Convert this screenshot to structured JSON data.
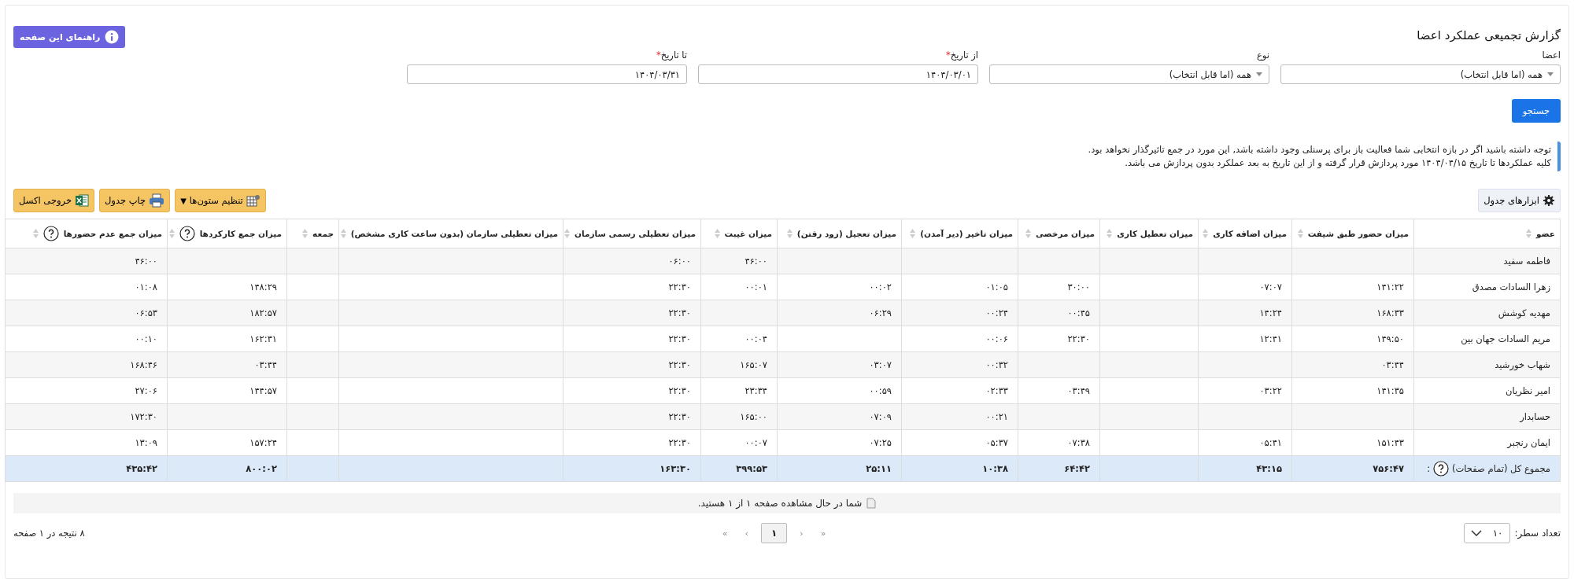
{
  "page": {
    "title": "گزارش تجمیعی عملکرد اعضا",
    "help_button": "راهنمای این صفحه"
  },
  "filters": [
    {
      "kind": "select",
      "label": "اعضا",
      "value": "همه (اما قابل انتخاب)"
    },
    {
      "kind": "select",
      "label": "نوع",
      "value": "همه (اما قابل انتخاب)"
    },
    {
      "kind": "date",
      "label": "از تاریخ",
      "required_mark": "*",
      "value": "۱۴۰۴/۰۳/۰۱"
    },
    {
      "kind": "date",
      "label": "تا تاریخ",
      "required_mark": "*",
      "value": "۱۴۰۴/۰۳/۳۱"
    }
  ],
  "search_button": "جستجو",
  "notice": [
    "توجه داشته باشید اگر در بازه انتخابی شما فعالیت باز برای پرسنلی وجود داشته باشد, این مورد در جمع تاثیرگذار نخواهد بود.",
    "کلیه عملکردها تا تاریخ ۱۴۰۴/۰۴/۱۵ مورد پردازش قرار گرفته و از این تاریخ به بعد عملکرد بدون پردازش می باشد."
  ],
  "toolbar": {
    "table_tools": "ابزارهای جدول",
    "buttons": [
      {
        "kind": "columns",
        "label": "تنظیم ستون‌ها",
        "caret": "▼"
      },
      {
        "kind": "print",
        "label": "چاپ جدول"
      },
      {
        "kind": "excel",
        "label": "خروجی اکسل"
      }
    ]
  },
  "table": {
    "columns": [
      {
        "label": "عضو"
      },
      {
        "label": "میزان حضور طبق شیفت"
      },
      {
        "label": "میزان اضافه کاری"
      },
      {
        "label": "میزان تعطیل کاری"
      },
      {
        "label": "میزان مرخصی"
      },
      {
        "label": "میزان تاخیر (دیر آمدن)"
      },
      {
        "label": "میزان تعجیل (زود رفتن)"
      },
      {
        "label": "میزان غیبت"
      },
      {
        "label": "میزان تعطیلی رسمی سازمان"
      },
      {
        "label": "میزان تعطیلی سازمان (بدون ساعت کاری مشخص)"
      },
      {
        "label": "جمعه"
      },
      {
        "label": "میزان جمع کارکردها",
        "help": true
      },
      {
        "label": "میزان جمع عدم حضورها",
        "help": true
      }
    ],
    "rows": [
      [
        "فاطمه سفید",
        null,
        null,
        null,
        null,
        null,
        null,
        "۴۶:۰۰",
        "۰۶:۰۰",
        null,
        null,
        null,
        "۴۶:۰۰"
      ],
      [
        "زهرا السادات مصدق",
        "۱۴۱:۲۲",
        "۰۷:۰۷",
        null,
        "۳۰:۰۰",
        "۰۱:۰۵",
        "۰۰:۰۲",
        "۰۰:۰۱",
        "۲۲:۳۰",
        null,
        null,
        "۱۴۸:۲۹",
        "۰۱:۰۸"
      ],
      [
        "مهدیه کوشش",
        "۱۶۸:۳۳",
        "۱۴:۲۴",
        null,
        "۰۰:۴۵",
        "۰۰:۲۴",
        "۰۶:۲۹",
        null,
        "۲۲:۳۰",
        null,
        null,
        "۱۸۲:۵۷",
        "۰۶:۵۳"
      ],
      [
        "مریم السادات جهان بین",
        "۱۴۹:۵۰",
        "۱۲:۴۱",
        null,
        "۲۲:۳۰",
        "۰۰:۰۶",
        null,
        "۰۰:۰۴",
        "۲۲:۳۰",
        null,
        null,
        "۱۶۲:۳۱",
        "۰۰:۱۰"
      ],
      [
        "شهاب خورشید",
        "۰۳:۴۴",
        null,
        null,
        null,
        "۰۰:۳۲",
        "۰۳:۰۷",
        "۱۶۵:۰۷",
        "۲۲:۳۰",
        null,
        null,
        "۰۳:۴۴",
        "۱۶۸:۴۶"
      ],
      [
        "امیر نظریان",
        "۱۴۱:۳۵",
        "۰۳:۲۲",
        null,
        "۰۳:۴۹",
        "۰۲:۳۳",
        "۰۰:۵۹",
        "۲۳:۳۴",
        "۲۲:۳۰",
        null,
        null,
        "۱۴۴:۵۷",
        "۲۷:۰۶"
      ],
      [
        "حسابدار",
        null,
        null,
        null,
        null,
        "۰۰:۲۱",
        "۰۷:۰۹",
        "۱۶۵:۰۰",
        "۲۲:۳۰",
        null,
        null,
        null,
        "۱۷۲:۳۰"
      ],
      [
        "ایمان رنجبر",
        "۱۵۱:۴۳",
        "۰۵:۴۱",
        null,
        "۰۷:۳۸",
        "۰۵:۳۷",
        "۰۷:۲۵",
        "۰۰:۰۷",
        "۲۲:۳۰",
        null,
        null,
        "۱۵۷:۲۴",
        "۱۳:۰۹"
      ]
    ],
    "total": {
      "label": "مجموع کل (تمام صفحات)",
      "help": true,
      "colon": ":",
      "cells": [
        "۷۵۶:۴۷",
        "۴۳:۱۵",
        null,
        "۶۴:۴۲",
        "۱۰:۳۸",
        "۲۵:۱۱",
        "۳۹۹:۵۳",
        "۱۶۳:۳۰",
        null,
        null,
        "۸۰۰:۰۲",
        "۴۳۵:۴۲"
      ]
    }
  },
  "page_notice": "شما در حال مشاهده صفحه ۱ از ۱ هستید.",
  "pagination": {
    "rows_label": "تعداد سطر:",
    "rows_value": "۱۰",
    "first": "«",
    "prev": "‹",
    "pages": [
      {
        "label": "۱",
        "selected": true
      }
    ],
    "next": "›",
    "last": "»",
    "summary": "۸ نتیجه در ۱ صفحه"
  }
}
